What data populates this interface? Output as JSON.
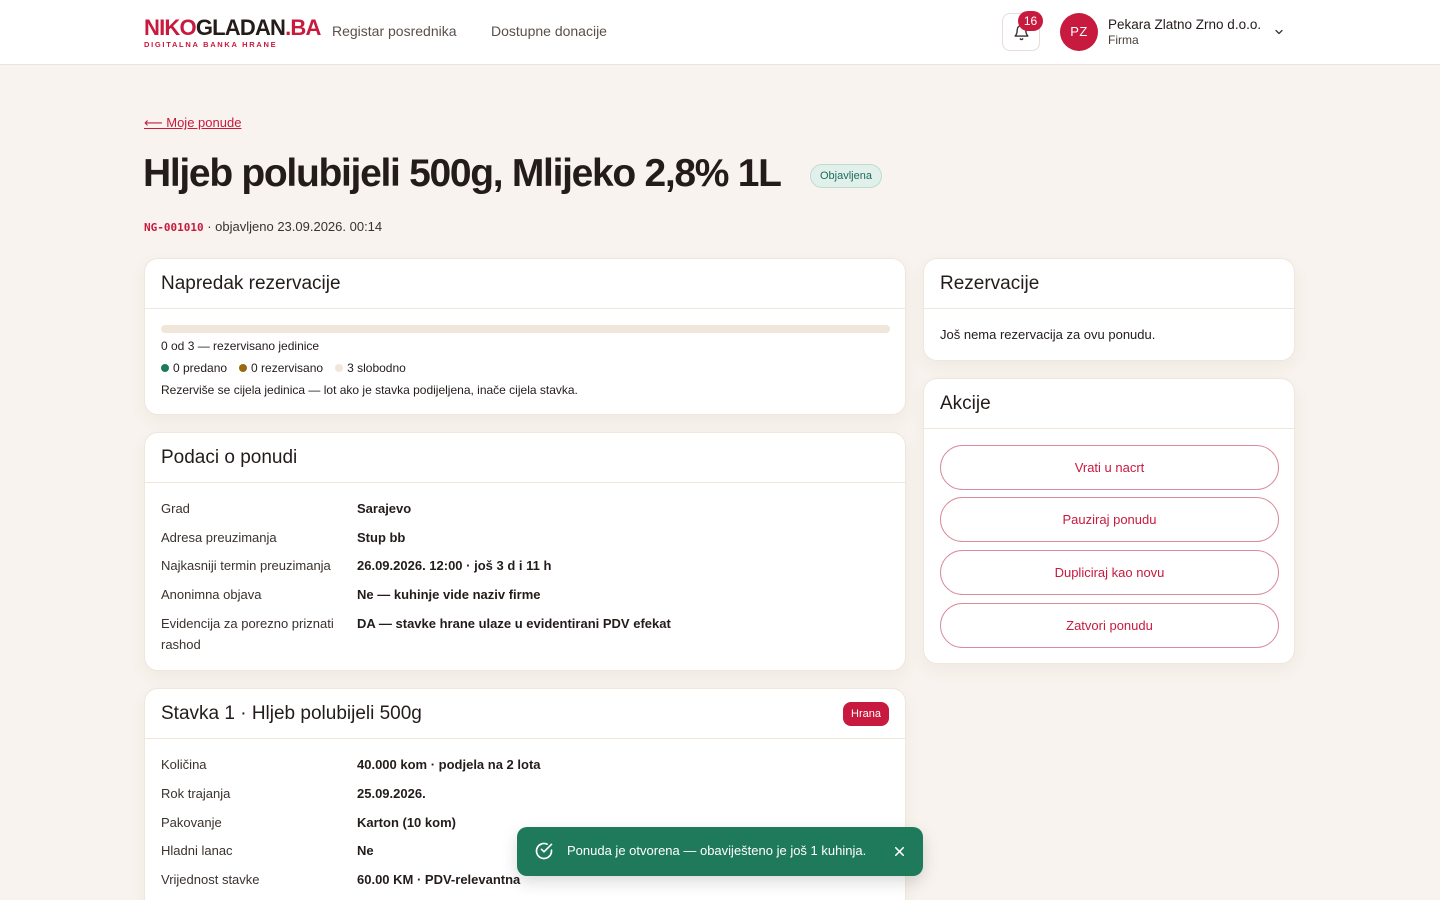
{
  "header": {
    "logo_main_red": "NIKO",
    "logo_main_dark": "GLADAN",
    "logo_main_suffix": ".BA",
    "logo_sub": "DIGITALNA BANKA HRANE",
    "nav": [
      "Registar posrednika",
      "Dostupne donacije"
    ],
    "notifications_count": "16",
    "user_initials": "PZ",
    "user_name": "Pekara Zlatno Zrno d.o.o.",
    "user_role": "Firma"
  },
  "page": {
    "back_link": "⟵ Moje ponude",
    "title": "Hljeb polubijeli 500g, Mlijeko 2,8% 1L",
    "status": "Objavljena",
    "code": "NG-001010",
    "meta_text": " · objavljeno 23.09.2026. 00:14"
  },
  "progress_card": {
    "title": "Napredak rezervacije",
    "reserved_fraction": 0,
    "summary": "0 od 3 — rezervisano jedinice",
    "legend": [
      {
        "label": "0 predano",
        "color": "#1f7a5c"
      },
      {
        "label": "0 rezervisano",
        "color": "#9a6a10"
      },
      {
        "label": "3 slobodno",
        "color": "#f1e6da"
      }
    ],
    "note": "Rezerviše se cijela jedinica — lot ako je stavka podijeljena, inače cijela stavka."
  },
  "details_card": {
    "title": "Podaci o ponudi",
    "rows": [
      {
        "key": "Grad",
        "value": "Sarajevo"
      },
      {
        "key": "Adresa preuzimanja",
        "value": "Stup bb"
      },
      {
        "key": "Najkasniji termin preuzimanja",
        "value": "26.09.2026. 12:00 · još 3 d i 11 h"
      },
      {
        "key": "Anonimna objava",
        "value": "Ne — kuhinje vide naziv firme"
      },
      {
        "key": "Evidencija za porezno priznati rashod",
        "value": "DA — stavke hrane ulaze u evidentirani PDV efekat"
      }
    ]
  },
  "item_card": {
    "title": "Stavka 1 · Hljeb polubijeli 500g",
    "category": "Hrana",
    "rows": [
      {
        "key": "Količina",
        "value": "40.000 kom · podjela na 2 lota"
      },
      {
        "key": "Rok trajanja",
        "value": "25.09.2026."
      },
      {
        "key": "Pakovanje",
        "value": "Karton (10 kom)"
      },
      {
        "key": "Hladni lanac",
        "value": "Ne"
      },
      {
        "key": "Vrijednost stavke",
        "value": "60.00 KM · PDV-relevantna"
      }
    ]
  },
  "reservations_card": {
    "title": "Rezervacije",
    "empty_text": "Još nema rezervacija za ovu ponudu."
  },
  "actions_card": {
    "title": "Akcije",
    "buttons": [
      "Vrati u nacrt",
      "Pauziraj ponudu",
      "Dupliciraj kao novu",
      "Zatvori ponudu"
    ]
  },
  "toast": {
    "text": "Ponuda je otvorena — obaviješteno je još 1 kuhinja."
  },
  "colors": {
    "accent": "#c8193f",
    "success": "#1f7a5c",
    "background": "#f8f3ee"
  }
}
